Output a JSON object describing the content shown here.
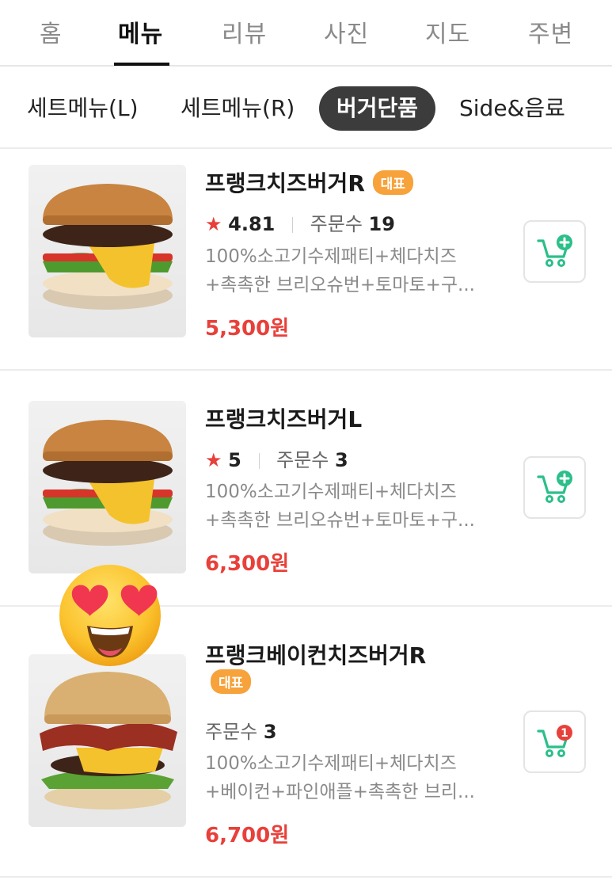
{
  "top_tabs": [
    "홈",
    "메뉴",
    "리뷰",
    "사진",
    "지도",
    "주변"
  ],
  "categories": [
    "세트메뉴(L)",
    "세트메뉴(R)",
    "버거단품",
    "Side&음료"
  ],
  "items": [
    {
      "name": "프랭크치즈버거R",
      "badge": "대표",
      "star": "★",
      "rating": "4.81",
      "orders_label": "주문수",
      "orders": "19",
      "desc_line1": "100%소고기수제패티+체다치즈",
      "desc_line2": "+촉촉한 브리오슈번+토마토+구...",
      "price": "5,300원"
    },
    {
      "name": "프랭크치즈버거L",
      "star": "★",
      "rating": "5",
      "orders_label": "주문수",
      "orders": "3",
      "desc_line1": "100%소고기수제패티+체다치즈",
      "desc_line2": "+촉촉한 브리오슈번+토마토+구...",
      "price": "6,300원"
    },
    {
      "name": "프랭크베이컨치즈버거R",
      "badge": "대표",
      "orders_label": "주문수",
      "orders": "3",
      "desc_line1": "100%소고기수제패티+체다치즈",
      "desc_line2": "+베이컨+파인애플+촉촉한 브리...",
      "price": "6,700원",
      "cart_count": "1"
    }
  ],
  "colors": {
    "accent_red": "#e8403a",
    "badge_orange": "#f7a23a",
    "cart_green": "#2bbf8a"
  },
  "icons": [
    "cart-add-icon",
    "cart-count-icon",
    "heart-eyes-emoji"
  ]
}
